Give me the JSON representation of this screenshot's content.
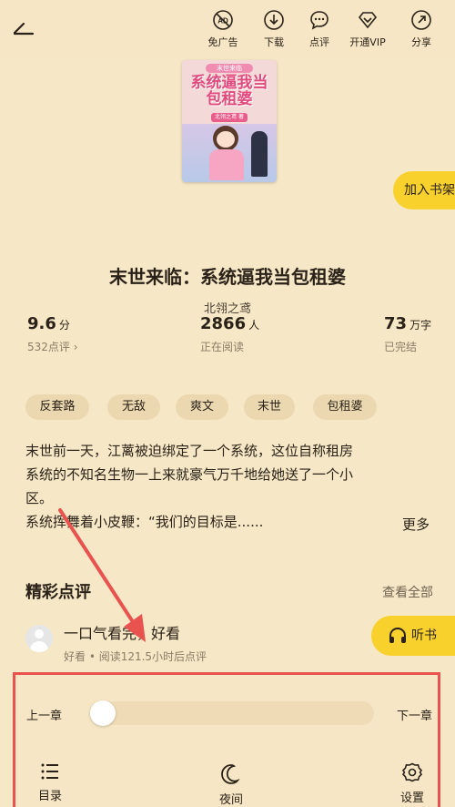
{
  "toolbar": {
    "items": [
      {
        "label": "免广告",
        "icon": "ad-free-icon"
      },
      {
        "label": "下载",
        "icon": "download-icon"
      },
      {
        "label": "点评",
        "icon": "comment-icon"
      },
      {
        "label": "开通VIP",
        "icon": "vip-diamond-icon"
      },
      {
        "label": "分享",
        "icon": "share-icon"
      }
    ]
  },
  "cover": {
    "top_line": "末世来临",
    "title": "系统逼我当包租婆",
    "author_tag": "北翎之鸢 著"
  },
  "shelf_button": "加入书架",
  "book": {
    "title": "末世来临：系统逼我当包租婆",
    "author": "北翎之鸢"
  },
  "stats": {
    "rating": {
      "value": "9.6",
      "unit": "分",
      "sub": "532点评 ›"
    },
    "readers": {
      "value": "2866",
      "unit": "人",
      "sub": "正在阅读"
    },
    "words": {
      "value": "73",
      "unit": "万字",
      "sub": "已完结"
    }
  },
  "tags": [
    "反套路",
    "无敌",
    "爽文",
    "末世",
    "包租婆"
  ],
  "synopsis": {
    "line1": "末世前一天，江蓠被迫绑定了一个系统，这位自称租房",
    "line2": "系统的不知名生物一上来就豪气万千地给她送了一个小",
    "line3": "区。",
    "line4": "系统挥舞着小皮鞭：“我们的目标是......",
    "more": "更多"
  },
  "reviews": {
    "title": "精彩点评",
    "view_all": "查看全部",
    "item": {
      "text": "一口气看完，好看",
      "meta": "好看 • 阅读121.5小时后点评"
    }
  },
  "listen_button": "听书",
  "bottom_panel": {
    "prev": "上一章",
    "next": "下一章",
    "progress": 0,
    "menu": [
      {
        "label": "目录",
        "icon": "catalog-icon"
      },
      {
        "label": "夜间",
        "icon": "moon-icon"
      },
      {
        "label": "设置",
        "icon": "settings-icon"
      }
    ]
  },
  "colors": {
    "background": "#f6e7c6",
    "accent_yellow": "#f9d12d",
    "highlight_red": "#e8524f"
  }
}
